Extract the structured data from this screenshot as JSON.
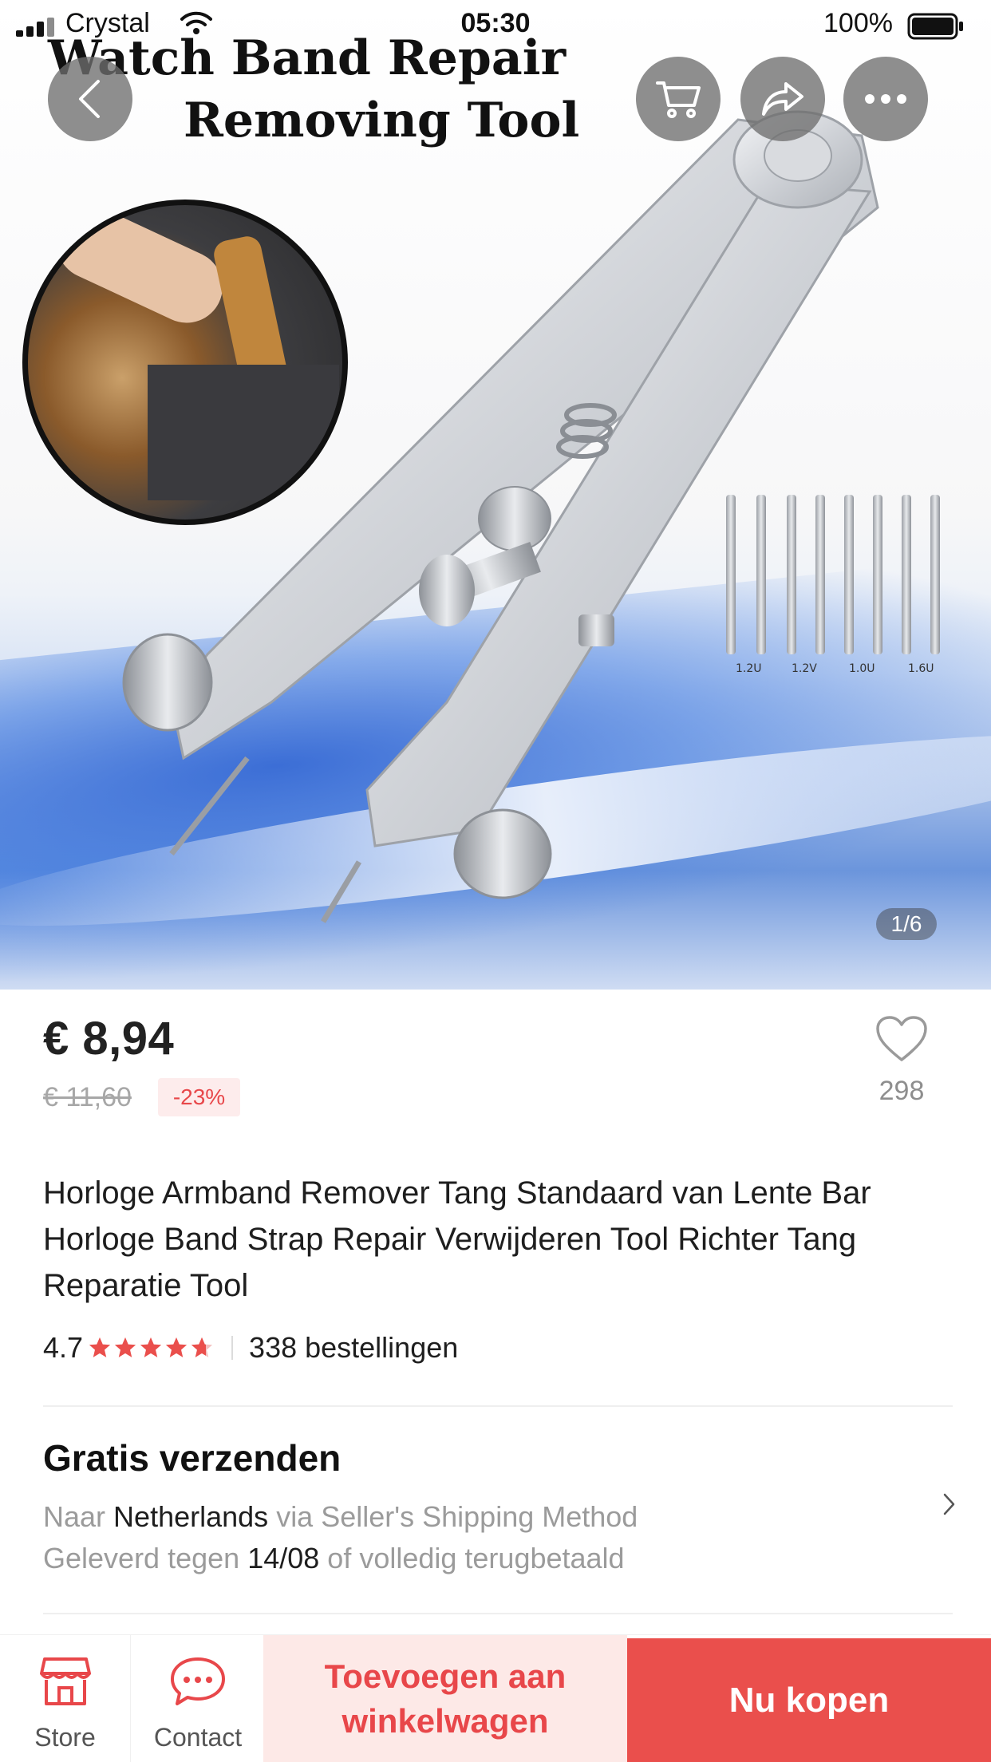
{
  "status_bar": {
    "carrier": "Crystal",
    "time": "05:30",
    "battery": "100%"
  },
  "hero": {
    "title_line1": "Watch Band Repair",
    "title_line2": "Removing Tool",
    "pin_labels": [
      "1.2U",
      "1.2V",
      "1.0U",
      "1.6U"
    ],
    "page_indicator": "1/6"
  },
  "product": {
    "price": "€ 8,94",
    "old_price": "€ 11,60",
    "discount": "-23%",
    "wishlist_count": "298",
    "title": "Horloge Armband Remover Tang Standaard van Lente Bar Horloge Band Strap Repair Verwijderen Tool Richter Tang Reparatie Tool",
    "rating": "4.7",
    "rating_value": 4.7,
    "orders": "338 bestellingen"
  },
  "shipping": {
    "title": "Gratis verzenden",
    "line1_prefix": "Naar",
    "line1_country": "Netherlands",
    "line1_suffix": "via Seller's Shipping Method",
    "line2_prefix": "Geleverd tegen",
    "line2_date": "14/08",
    "line2_suffix": "of volledig terugbetaald"
  },
  "bottom_bar": {
    "store_label": "Store",
    "contact_label": "Contact",
    "add_to_cart_label": "Toevoegen aan winkelwagen",
    "buy_now_label": "Nu kopen"
  },
  "colors": {
    "accent": "#ea4f4c",
    "accent_light": "#fde9e7",
    "discount_bg": "#fdecec",
    "muted_text": "#9b9b9b"
  },
  "icons": {
    "back": "chevron-left-icon",
    "cart": "cart-icon",
    "share": "share-icon",
    "more": "more-dots-icon",
    "wishlist": "heart-icon",
    "store": "store-icon",
    "contact": "chat-bubble-icon",
    "shipping_more": "chevron-right-icon"
  }
}
